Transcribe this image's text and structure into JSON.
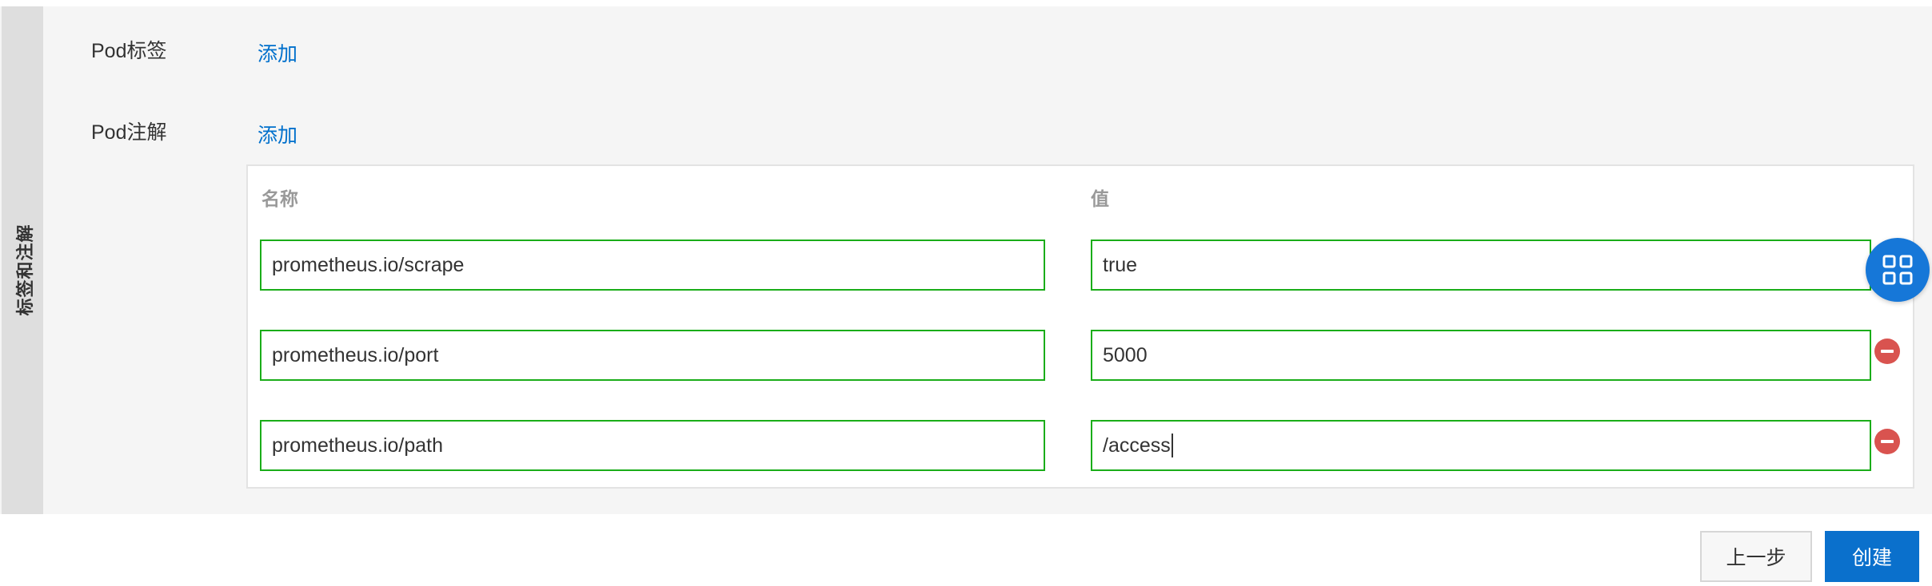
{
  "section": {
    "side_tab_label": "标签和注解"
  },
  "pod_labels": {
    "label": "Pod标签",
    "add_link": "添加"
  },
  "pod_annotations": {
    "label": "Pod注解",
    "add_link": "添加",
    "columns": {
      "name": "名称",
      "value": "值"
    },
    "rows": [
      {
        "name": "prometheus.io/scrape",
        "value": "true"
      },
      {
        "name": "prometheus.io/port",
        "value": "5000"
      },
      {
        "name": "prometheus.io/path",
        "value": "/access"
      }
    ]
  },
  "footer": {
    "prev_label": "上一步",
    "create_label": "创建"
  },
  "icons": {
    "fab": "grid-icon",
    "remove": "minus-circle-icon"
  },
  "colors": {
    "link": "#0070cc",
    "input_border_valid": "#1aad19",
    "remove_red": "#d9534f",
    "primary_button": "#0a70cc",
    "fab_blue": "#1677d8"
  }
}
